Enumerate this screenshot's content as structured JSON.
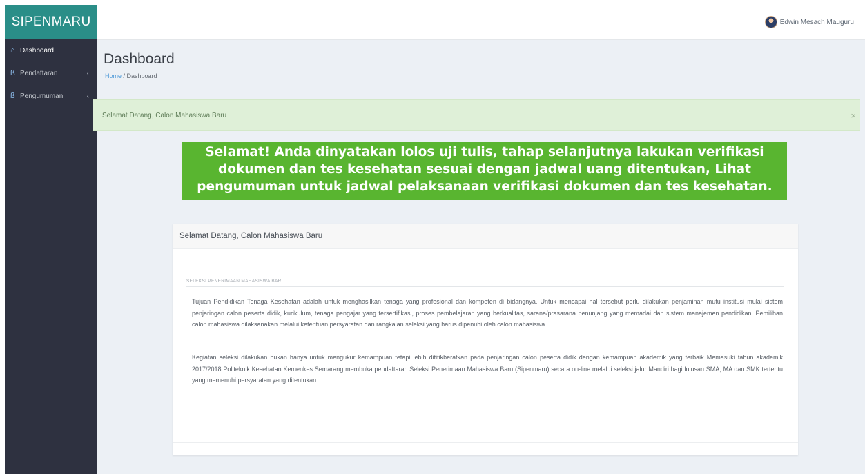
{
  "app": {
    "brand": "SIPENMARU"
  },
  "sidebar": {
    "items": [
      {
        "label": "Dashboard",
        "icon": "home-icon"
      },
      {
        "label": "Pendaftaran",
        "icon": "user-icon"
      },
      {
        "label": "Pengumuman",
        "icon": "user-icon"
      }
    ]
  },
  "header": {
    "user_name": "Edwin Mesach Mauguru"
  },
  "page": {
    "title": "Dashboard",
    "breadcrumb_home": "Home",
    "breadcrumb_sep": " / ",
    "breadcrumb_current": "Dashboard"
  },
  "alert": {
    "text": "Selamat Datang, Calon Mahasiswa Baru",
    "close": "×"
  },
  "banner": {
    "text": "Selamat! Anda dinyatakan lolos uji tulis, tahap selanjutnya lakukan verifikasi dokumen dan tes kesehatan sesuai dengan jadwal uang ditentukan, Lihat pengumuman untuk jadwal pelaksanaan verifikasi dokumen dan tes kesehatan."
  },
  "card": {
    "title": "Selamat Datang, Calon Mahasiswa Baru",
    "section_title": "SELEKSI PENERIMAAN MAHASISWA BARU",
    "paragraph1": "Tujuan Pendidikan Tenaga Kesehatan adalah untuk menghasilkan tenaga yang profesional dan kompeten di bidangnya. Untuk mencapai hal tersebut perlu dilakukan penjaminan mutu institusi mulai sistem penjaringan calon peserta didik, kurikulum, tenaga pengajar yang tersertifikasi, proses pembelajaran yang berkualitas, sarana/prasarana penunjang yang memadai dan sistem manajemen pendidikan. Pemilihan calon mahasiswa dilaksanakan melalui ketentuan persyaratan dan rangkaian seleksi yang harus dipenuhi oleh calon mahasiswa.",
    "paragraph2": "Kegiatan seleksi dilakukan bukan hanya untuk mengukur kemampuan tetapi lebih dititikberatkan pada penjaringan calon peserta didik dengan kemampuan akademik yang terbaik Memasuki tahun akademik 2017/2018 Politeknik Kesehatan Kemenkes Semarang membuka pendaftaran Seleksi Penerimaan Mahasiswa Baru (Sipenmaru) secara on-line melalui seleksi jalur Mandiri bagi lulusan SMA, MA dan SMK tertentu yang memenuhi persyaratan yang ditentukan."
  },
  "colors": {
    "brand": "#2a8e88",
    "sidebar": "#2e3140",
    "banner": "#59b530",
    "alert_bg": "#dff0d8"
  }
}
